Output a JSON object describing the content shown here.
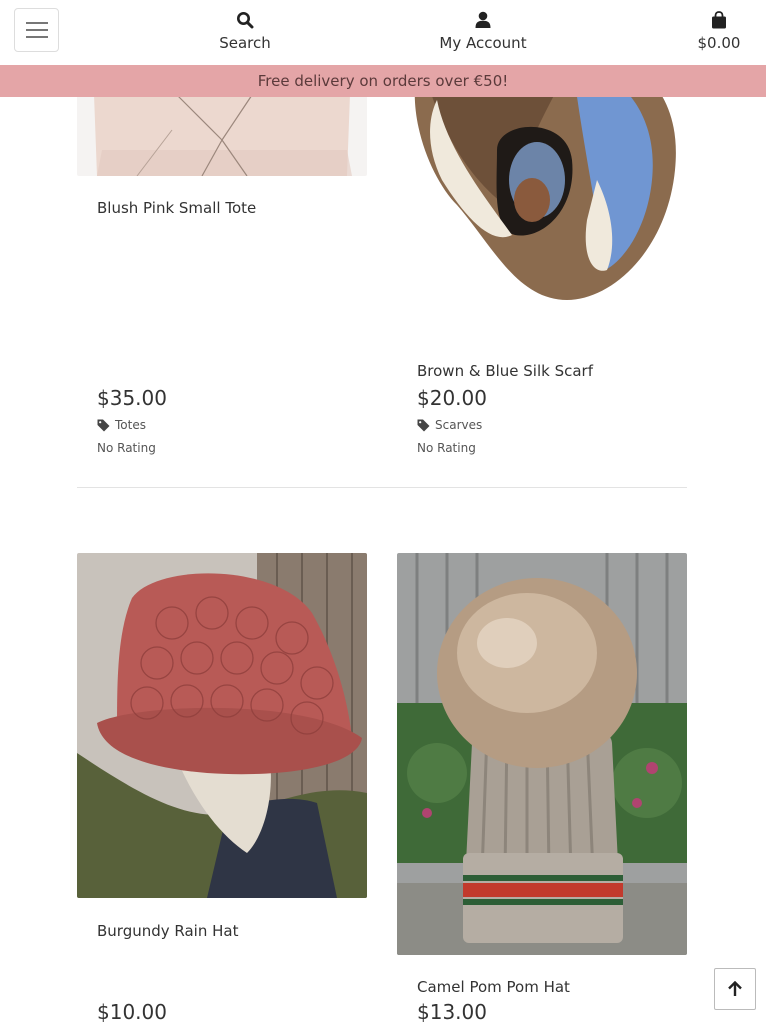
{
  "nav": {
    "search_label": "Search",
    "account_label": "My Account",
    "cart_total": "$0.00"
  },
  "banner": {
    "text": "Free delivery on orders over €50!"
  },
  "products": [
    {
      "title": "Blush Pink Small Tote",
      "price": "$35.00",
      "category": "Totes",
      "rating": "No Rating"
    },
    {
      "title": "Brown & Blue Silk Scarf",
      "price": "$20.00",
      "category": "Scarves",
      "rating": "No Rating"
    },
    {
      "title": "Burgundy Rain Hat",
      "price": "$10.00"
    },
    {
      "title": "Camel Pom Pom Hat",
      "price": "$13.00"
    }
  ],
  "icons": {
    "menu": "hamburger-icon",
    "search": "search-icon",
    "account": "user-icon",
    "cart": "shopping-bag-icon",
    "tag": "tag-icon",
    "back_to_top": "arrow-up-icon"
  },
  "colors": {
    "banner_bg": "#e4a5a7",
    "text": "#333333"
  }
}
